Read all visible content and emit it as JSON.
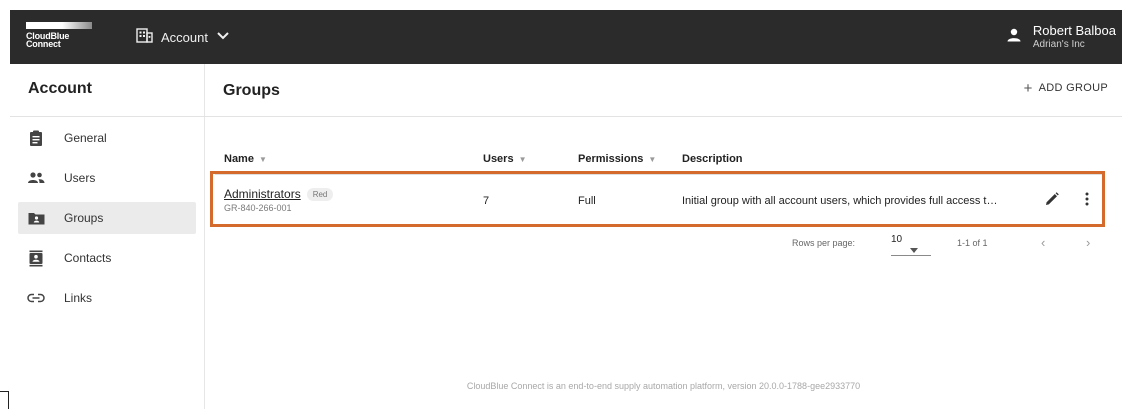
{
  "brand": {
    "line1": "CloudBlue",
    "line2": "Connect"
  },
  "topbar": {
    "account_label": "Account",
    "account_icon": "building-icon",
    "user_icon": "person-icon"
  },
  "user": {
    "name": "Robert Balboa",
    "org": "Adrian's Inc"
  },
  "sidebar": {
    "title": "Account",
    "items": [
      {
        "label": "General",
        "icon": "clipboard-icon",
        "active": false
      },
      {
        "label": "Users",
        "icon": "people-icon",
        "active": false
      },
      {
        "label": "Groups",
        "icon": "folder-people-icon",
        "active": true
      },
      {
        "label": "Contacts",
        "icon": "contact-card-icon",
        "active": false
      },
      {
        "label": "Links",
        "icon": "link-icon",
        "active": false
      }
    ]
  },
  "page": {
    "title": "Groups",
    "add_button": "ADD GROUP"
  },
  "table": {
    "columns": [
      "Name",
      "Users",
      "Permissions",
      "Description"
    ],
    "rows": [
      {
        "name": "Administrators",
        "badge": "Red",
        "id": "GR-840-266-001",
        "users": "7",
        "permissions": "Full",
        "description": "Initial group with all account users, which provides full access t…"
      }
    ]
  },
  "pagination": {
    "rows_per_page_label": "Rows per page:",
    "rows_per_page": "10",
    "range": "1-1 of 1",
    "prev": "‹",
    "next": "›"
  },
  "footer": "CloudBlue Connect is an end-to-end supply automation platform, version 20.0.0-1788-gee2933770",
  "colors": {
    "topbar": "#2b2b2b",
    "highlight": "#d46a2c",
    "active_item": "#ebebeb"
  }
}
